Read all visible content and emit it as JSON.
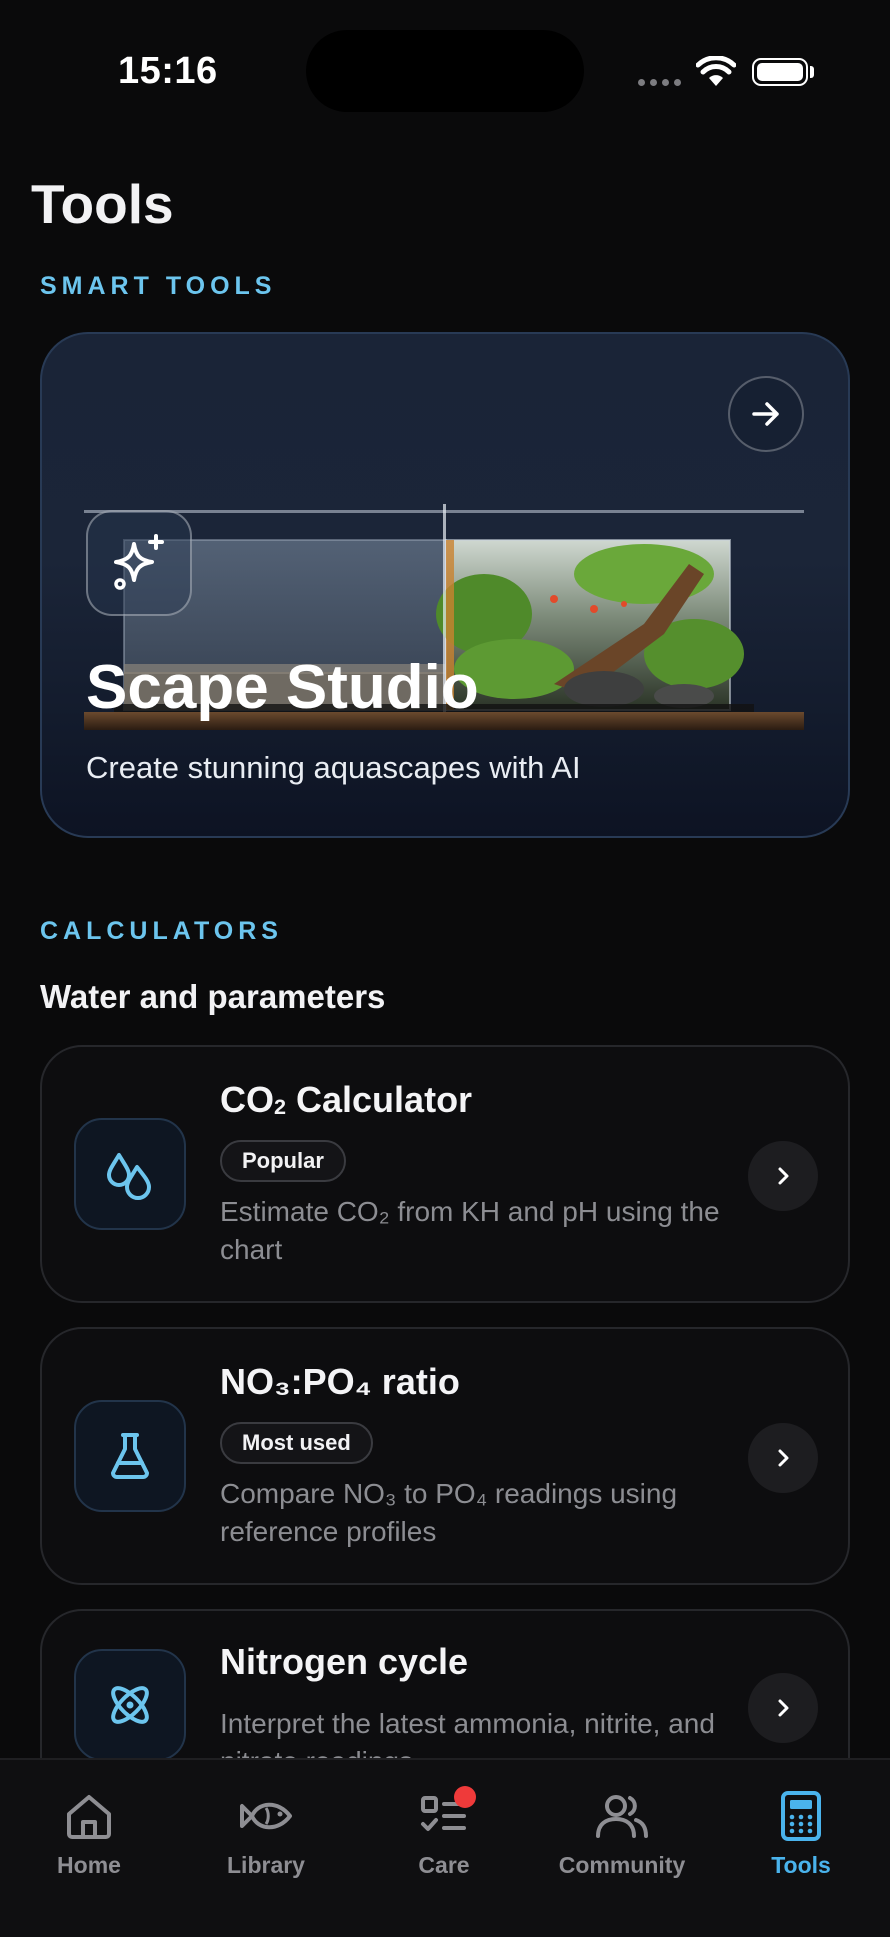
{
  "status": {
    "time": "15:16"
  },
  "page": {
    "title": "Tools"
  },
  "smart_tools": {
    "label": "SMART TOOLS",
    "hero": {
      "title": "Scape Studio",
      "subtitle": "Create stunning aquascapes with AI"
    }
  },
  "calculators": {
    "label": "CALCULATORS",
    "group": "Water and parameters",
    "items": [
      {
        "title_a": "CO",
        "title_sub": "2",
        "title_b": " Calculator",
        "badge": "Popular",
        "desc": "Estimate CO₂ from KH and pH using the chart",
        "icon": "drops-icon"
      },
      {
        "title": "NO₃:PO₄ ratio",
        "badge": "Most used",
        "desc": "Compare NO₃ to PO₄ readings using reference profiles",
        "icon": "flask-icon"
      },
      {
        "title": "Nitrogen cycle",
        "desc": "Interpret the latest ammonia, nitrite, and nitrate readings",
        "icon": "atom-icon"
      }
    ]
  },
  "tabs": [
    {
      "label": "Home",
      "icon": "home-icon"
    },
    {
      "label": "Library",
      "icon": "fish-icon"
    },
    {
      "label": "Care",
      "icon": "checklist-icon"
    },
    {
      "label": "Community",
      "icon": "people-icon"
    },
    {
      "label": "Tools",
      "icon": "calculator-icon",
      "active": true
    }
  ],
  "colors": {
    "accent": "#4ab3ec",
    "section_label": "#6cc5ee",
    "notification": "#ef3a3a",
    "background": "#0a0a0b"
  }
}
